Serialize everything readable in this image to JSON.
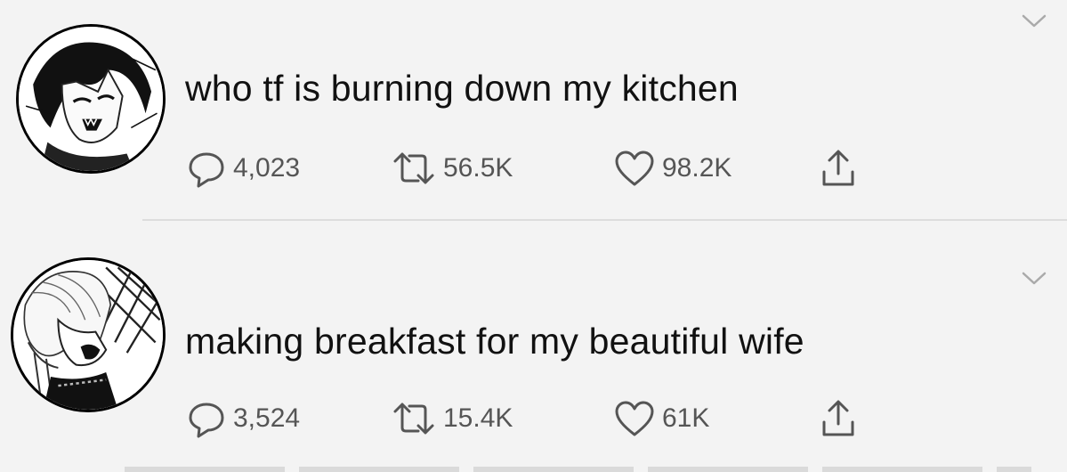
{
  "tweets": [
    {
      "text": "who tf is burning down my kitchen",
      "replies": "4,023",
      "retweets": "56.5K",
      "likes": "98.2K",
      "avatar_icon": "dark-haired-anime-character-avatar"
    },
    {
      "text": "making breakfast for my beautiful wife",
      "replies": "3,524",
      "retweets": "15.4K",
      "likes": "61K",
      "avatar_icon": "light-haired-anime-character-avatar"
    }
  ],
  "icons": {
    "reply": "reply-icon",
    "retweet": "retweet-icon",
    "like": "heart-icon",
    "share": "share-icon",
    "more": "chevron-down-icon"
  },
  "colors": {
    "background": "#f3f3f3",
    "icon": "#555555",
    "text": "#111111"
  }
}
